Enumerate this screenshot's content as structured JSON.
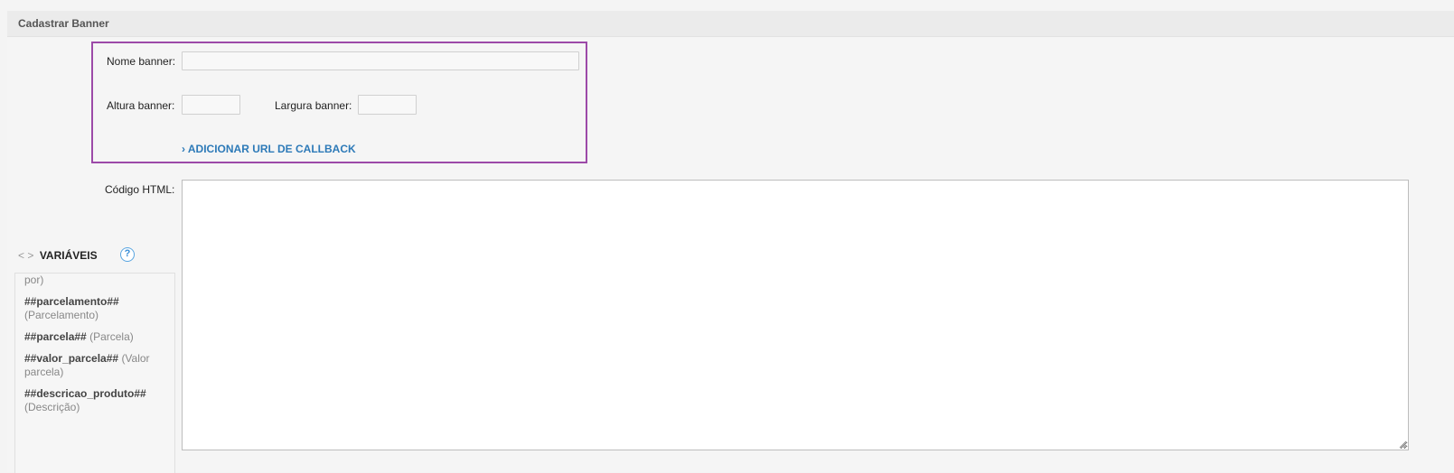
{
  "panel": {
    "title": "Cadastrar Banner"
  },
  "form": {
    "nome_banner_label": "Nome banner:",
    "nome_banner_value": "",
    "altura_banner_label": "Altura banner:",
    "altura_banner_value": "",
    "largura_banner_label": "Largura banner:",
    "largura_banner_value": "",
    "callback_link": "› ADICIONAR URL DE CALLBACK",
    "codigo_html_label": "Código HTML:",
    "codigo_html_value": ""
  },
  "variables": {
    "chevrons": "< >",
    "title": "VARIÁVEIS",
    "help_icon": "question-mark-icon",
    "help_symbol": "?",
    "items": [
      {
        "name": "",
        "desc": "por)"
      },
      {
        "name": "##parcelamento##",
        "desc": "(Parcelamento)"
      },
      {
        "name": "##parcela##",
        "desc": "(Parcela)"
      },
      {
        "name": "##valor_parcela##",
        "desc": "(Valor parcela)"
      },
      {
        "name": "##descricao_produto##",
        "desc": "(Descrição)"
      }
    ]
  },
  "colors": {
    "highlight_border": "#9c4aa8",
    "link": "#2d7ab8",
    "help_icon": "#3a8dd6"
  }
}
